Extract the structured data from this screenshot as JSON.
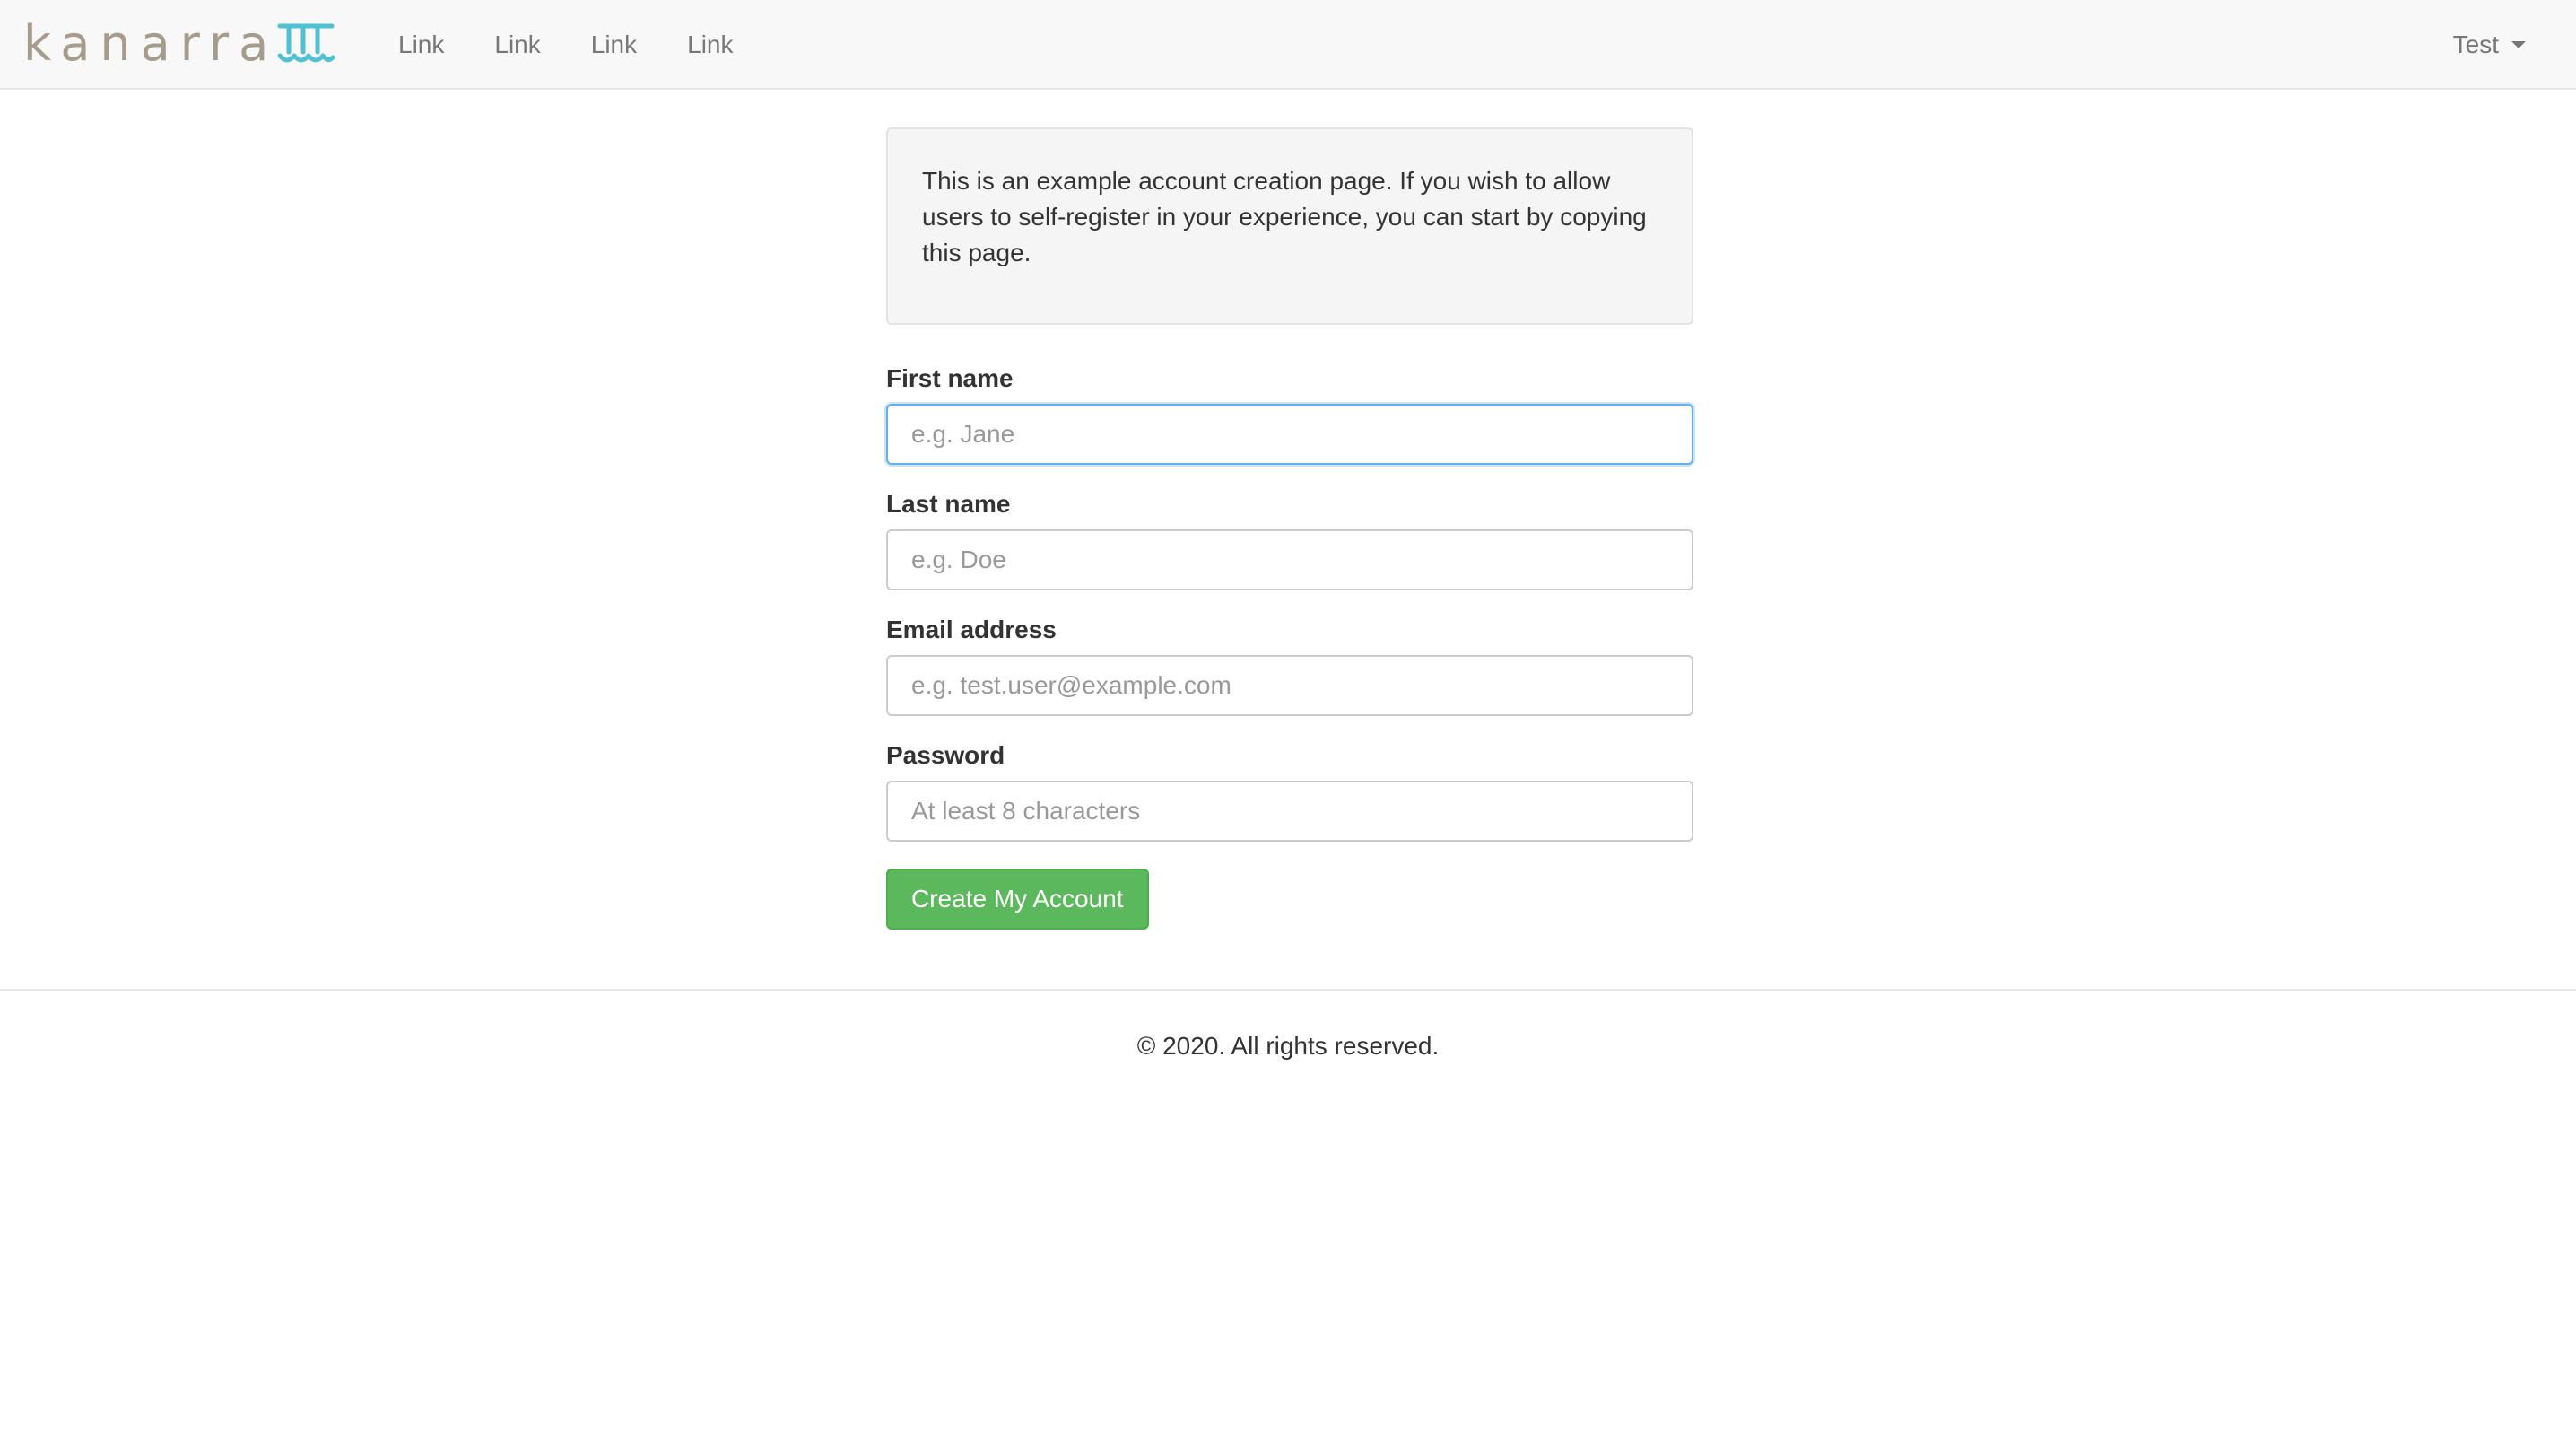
{
  "brand": {
    "name": "kanarra",
    "mark_icon": "wave-columns-icon",
    "mark_color": "#4fc1d2"
  },
  "nav": {
    "links": [
      "Link",
      "Link",
      "Link",
      "Link"
    ],
    "user_menu": {
      "label": "Test",
      "icon": "caret-down-icon"
    }
  },
  "notice": {
    "text": "This is an example account creation page. If you wish to allow users to self-register in your experience, you can start by copying this page."
  },
  "form": {
    "first_name": {
      "label": "First name",
      "placeholder": "e.g. Jane",
      "value": ""
    },
    "last_name": {
      "label": "Last name",
      "placeholder": "e.g. Doe",
      "value": ""
    },
    "email": {
      "label": "Email address",
      "placeholder": "e.g. test.user@example.com",
      "value": ""
    },
    "password": {
      "label": "Password",
      "placeholder": "At least 8 characters",
      "value": ""
    },
    "submit_label": "Create My Account"
  },
  "footer": {
    "text": "© 2020. All rights reserved."
  },
  "colors": {
    "navbar_bg": "#f8f8f8",
    "brand_text": "#a69c8c",
    "accent_success": "#5cb85c",
    "focus_border": "#66afe9"
  }
}
